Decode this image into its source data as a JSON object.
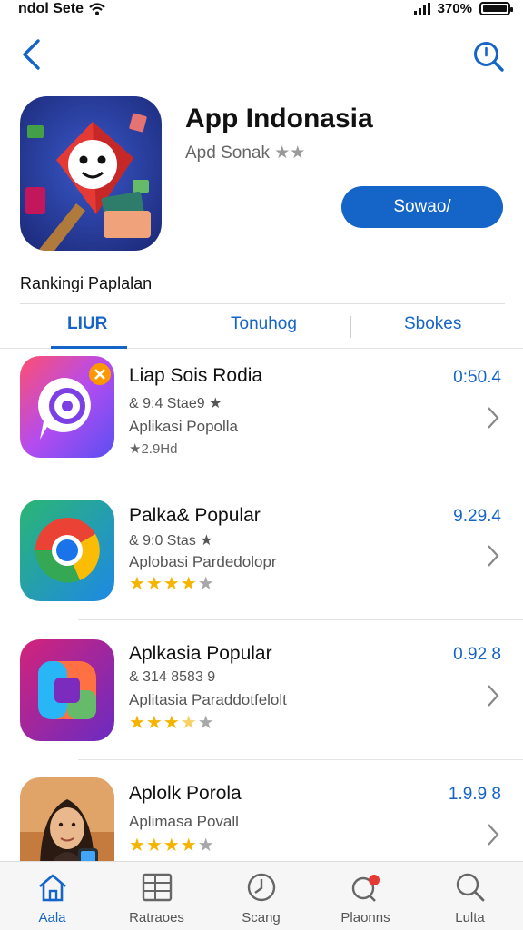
{
  "status_bar": {
    "carrier": "ndol Sete",
    "battery": "370%"
  },
  "app": {
    "title": "App Indonasia",
    "subtitle": "Apd Sonak",
    "get_label": "Sowao/"
  },
  "section": {
    "title": "Rankingi Paplalan"
  },
  "tabs": [
    {
      "label": "LIUR",
      "active": true
    },
    {
      "label": "Tonuhog",
      "active": false
    },
    {
      "label": "Sbokes",
      "active": false
    }
  ],
  "list": [
    {
      "name": "Liap Sois Rodia",
      "meta": "& 9:4 Stae9 ★",
      "desc": "Aplikasi Popolla",
      "count": "★2.9Hd",
      "price": "0:50.4",
      "rating": 0
    },
    {
      "name": "Palka& Popular",
      "meta": "& 9:0 Stas ★",
      "desc": "Aplobasi Pardedolopr",
      "price": "9.29.4",
      "rating": 4
    },
    {
      "name": "Aplkasia Popular",
      "meta": "& 314 8583  9",
      "desc": "Aplitasia Paraddotfelolt",
      "price": "0.92 8",
      "rating": 3.5
    },
    {
      "name": "Aplolk Porola",
      "desc": "Aplimasa Povall",
      "price": "1.9.9 8",
      "rating": 4
    }
  ],
  "tabbar": [
    {
      "label": "Aala",
      "icon": "home-icon",
      "active": true
    },
    {
      "label": "Ratraoes",
      "icon": "apps-icon",
      "active": false
    },
    {
      "label": "Scang",
      "icon": "clock-icon",
      "active": false
    },
    {
      "label": "Plaonns",
      "icon": "notification-icon",
      "active": false
    },
    {
      "label": "Lulta",
      "icon": "search-icon",
      "active": false
    }
  ],
  "colors": {
    "accent": "#1565c8",
    "star": "#f5b400"
  }
}
